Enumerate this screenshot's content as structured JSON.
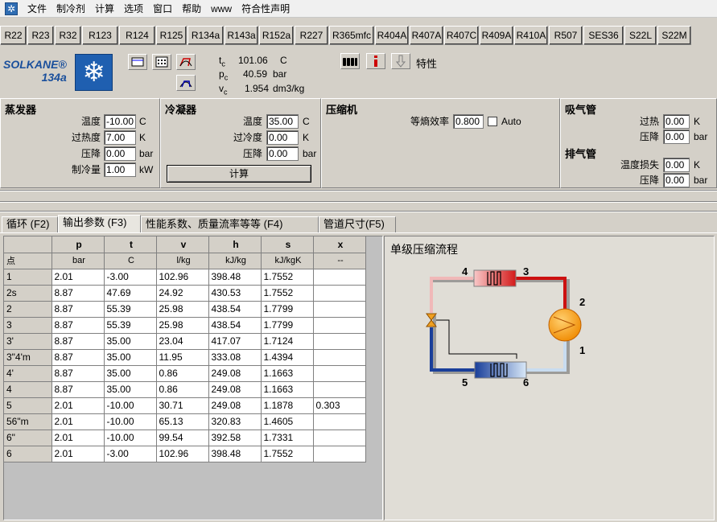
{
  "menu": [
    "文件",
    "制冷剂",
    "计算",
    "选项",
    "窗口",
    "帮助",
    "www",
    "符合性声明"
  ],
  "refrigerants": [
    "R22",
    "R23",
    "R32",
    "R123",
    "R124",
    "R125",
    "R134a",
    "R143a",
    "R152a",
    "R227",
    "R365mfc",
    "R404A",
    "R407A",
    "R407C",
    "R409A",
    "R410A",
    "R507",
    "SES36",
    "S22L",
    "S22M"
  ],
  "logo": {
    "brand": "SOLKANE®",
    "product": "134a"
  },
  "stats": [
    {
      "sym": "t",
      "sub": "c",
      "value": "101.06",
      "unit": "C"
    },
    {
      "sym": "p",
      "sub": "c",
      "value": "40.59",
      "unit": "bar"
    },
    {
      "sym": "v",
      "sub": "c",
      "value": "1.954",
      "unit": "dm3/kg"
    }
  ],
  "properties_label": "特性",
  "evaporator": {
    "title": "蒸发器",
    "rows": [
      {
        "label": "温度",
        "value": "-10.00",
        "unit": "C"
      },
      {
        "label": "过热度",
        "value": "7.00",
        "unit": "K"
      },
      {
        "label": "压降",
        "value": "0.00",
        "unit": "bar"
      },
      {
        "label": "制冷量",
        "value": "1.00",
        "unit": "kW"
      }
    ]
  },
  "condenser": {
    "title": "冷凝器",
    "rows": [
      {
        "label": "温度",
        "value": "35.00",
        "unit": "C"
      },
      {
        "label": "过冷度",
        "value": "0.00",
        "unit": "K"
      },
      {
        "label": "压降",
        "value": "0.00",
        "unit": "bar"
      }
    ],
    "calc_button": "计算"
  },
  "compressor": {
    "title": "压缩机",
    "efficiency_label": "等熵效率",
    "efficiency_value": "0.800",
    "auto_label": "Auto"
  },
  "suction": {
    "title": "吸气管",
    "rows": [
      {
        "label": "过热",
        "value": "0.00",
        "unit": "K"
      },
      {
        "label": "压降",
        "value": "0.00",
        "unit": "bar"
      }
    ]
  },
  "discharge": {
    "title": "排气管",
    "rows": [
      {
        "label": "温度损失",
        "value": "0.00",
        "unit": "K"
      },
      {
        "label": "压降",
        "value": "0.00",
        "unit": "bar"
      }
    ]
  },
  "tabs": [
    "循环 (F2)",
    "输出参数 (F3)",
    "性能系数、质量流率等等 (F4)",
    "管道尺寸(F5)"
  ],
  "table": {
    "headers": [
      "",
      "p",
      "t",
      "v",
      "h",
      "s",
      "x"
    ],
    "units": [
      "点",
      "bar",
      "C",
      "l/kg",
      "kJ/kg",
      "kJ/kgK",
      "--"
    ],
    "rows": [
      [
        "1",
        "2.01",
        "-3.00",
        "102.96",
        "398.48",
        "1.7552",
        ""
      ],
      [
        "2s",
        "8.87",
        "47.69",
        "24.92",
        "430.53",
        "1.7552",
        ""
      ],
      [
        "2",
        "8.87",
        "55.39",
        "25.98",
        "438.54",
        "1.7799",
        ""
      ],
      [
        "3",
        "8.87",
        "55.39",
        "25.98",
        "438.54",
        "1.7799",
        ""
      ],
      [
        "3'",
        "8.87",
        "35.00",
        "23.04",
        "417.07",
        "1.7124",
        ""
      ],
      [
        "3\"4'm",
        "8.87",
        "35.00",
        "11.95",
        "333.08",
        "1.4394",
        ""
      ],
      [
        "4'",
        "8.87",
        "35.00",
        "0.86",
        "249.08",
        "1.1663",
        ""
      ],
      [
        "4",
        "8.87",
        "35.00",
        "0.86",
        "249.08",
        "1.1663",
        ""
      ],
      [
        "5",
        "2.01",
        "-10.00",
        "30.71",
        "249.08",
        "1.1878",
        "0.303"
      ],
      [
        "56\"m",
        "2.01",
        "-10.00",
        "65.13",
        "320.83",
        "1.4605",
        ""
      ],
      [
        "6\"",
        "2.01",
        "-10.00",
        "99.54",
        "392.58",
        "1.7331",
        ""
      ],
      [
        "6",
        "2.01",
        "-3.00",
        "102.96",
        "398.48",
        "1.7552",
        ""
      ]
    ]
  },
  "diagram": {
    "title": "单级压缩流程",
    "labels": [
      "1",
      "2",
      "3",
      "4",
      "5",
      "6"
    ]
  }
}
